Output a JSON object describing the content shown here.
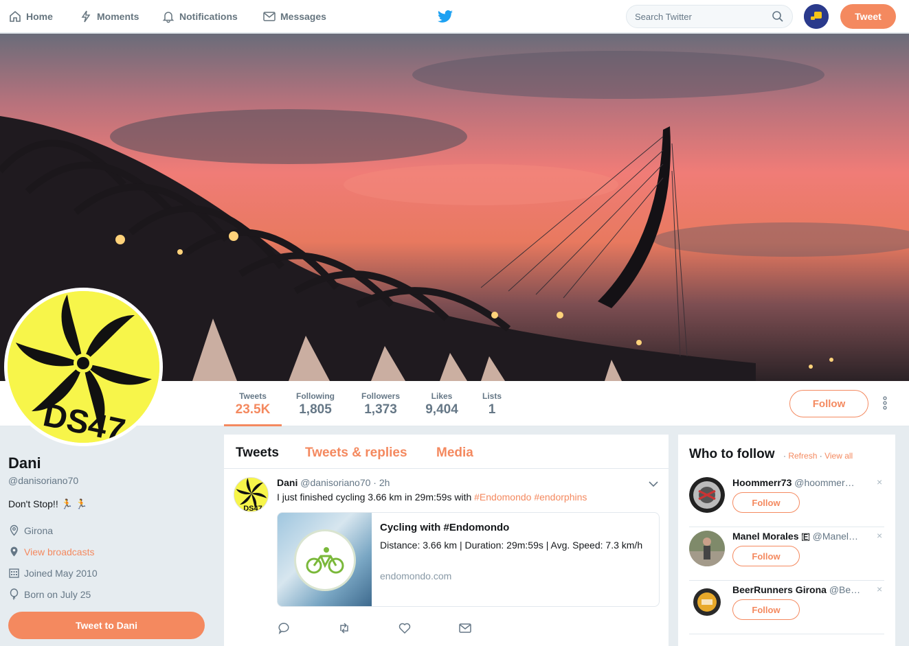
{
  "nav": {
    "home": "Home",
    "moments": "Moments",
    "notifications": "Notifications",
    "messages": "Messages",
    "search_placeholder": "Search Twitter",
    "tweet_button": "Tweet"
  },
  "profile": {
    "name": "Dani",
    "handle": "@danisoriano70",
    "bio": "Don't Stop!! 🏃 🏃",
    "location": "Girona",
    "broadcasts": "View broadcasts",
    "joined": "Joined May 2010",
    "born": "Born on July 25",
    "tweet_to": "Tweet to Dani",
    "avatar_text": "DS47"
  },
  "stats": [
    {
      "label": "Tweets",
      "value": "23.5K"
    },
    {
      "label": "Following",
      "value": "1,805"
    },
    {
      "label": "Followers",
      "value": "1,373"
    },
    {
      "label": "Likes",
      "value": "9,404"
    },
    {
      "label": "Lists",
      "value": "1"
    }
  ],
  "follow_button": "Follow",
  "tabs": [
    "Tweets",
    "Tweets & replies",
    "Media"
  ],
  "tweet": {
    "name": "Dani",
    "handle": "@danisoriano70",
    "sep": "·",
    "time": "2h",
    "text_plain": "I just finished cycling 3.66 km in 29m:59s with ",
    "hashtag1": "#Endomondo",
    "hashtag2": "#endorphins",
    "card_title": "Cycling with #Endomondo",
    "card_desc": "Distance: 3.66 km | Duration: 29m:59s | Avg. Speed: 7.3 km/h",
    "card_url": "endomondo.com"
  },
  "who_to_follow": {
    "title": "Who to follow",
    "refresh": "Refresh",
    "view_all": "View all",
    "sep": "·",
    "close": "×",
    "follow_label": "Follow",
    "suggestions": [
      {
        "name": "Hoommerr73",
        "handle": "@hoommer…"
      },
      {
        "name": "Manel Morales 🇪",
        "handle": "@Manel…"
      },
      {
        "name": "BeerRunners Girona",
        "handle": "@Be…"
      }
    ]
  },
  "colors": {
    "accent": "#f4895f",
    "twitter_blue": "#1da1f2",
    "avatar_yellow": "#f7f54a"
  }
}
